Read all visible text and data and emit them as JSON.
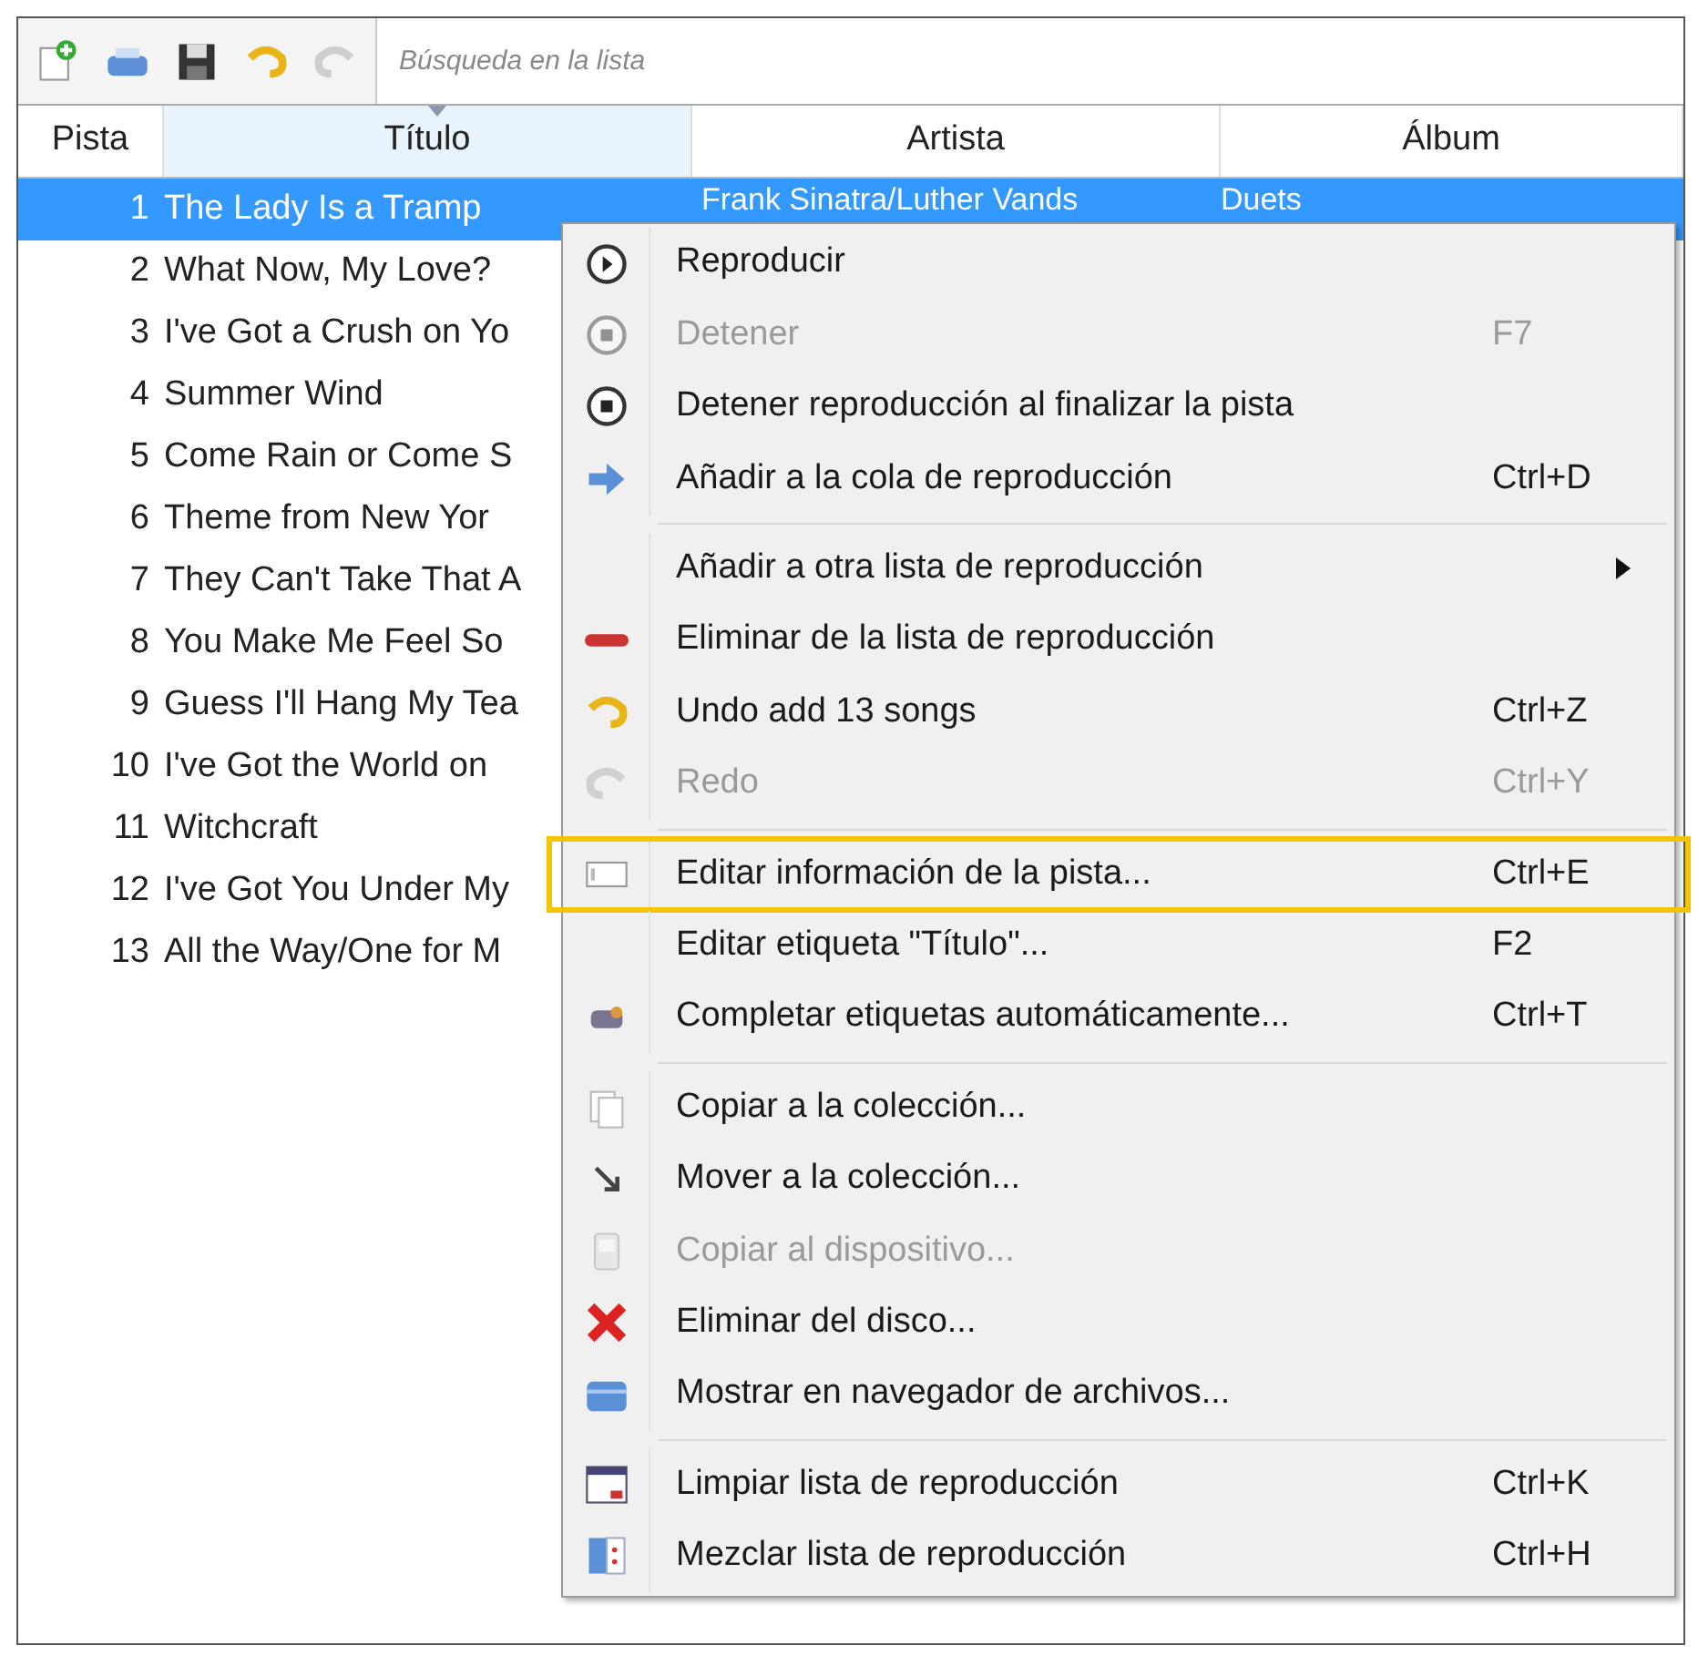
{
  "toolbar": {
    "buttons": [
      {
        "disabled": false
      },
      {
        "disabled": false
      },
      {
        "disabled": false
      },
      {
        "disabled": false
      },
      {
        "disabled": true
      }
    ],
    "search": {
      "placeholder": "Búsqueda en la lista"
    }
  },
  "table": {
    "columns": [
      {
        "label": "Pista",
        "sorted": false
      },
      {
        "label": "Título",
        "sorted": true
      },
      {
        "label": "Artista",
        "sorted": false
      },
      {
        "label": "Álbum",
        "sorted": false
      }
    ],
    "rows": [
      {
        "track": "1",
        "title": "The Lady Is a Tramp",
        "artist": "Frank Sinatra/Luther Vands",
        "album": "Duets",
        "selected": true
      },
      {
        "track": "2",
        "title": "What Now, My Love?",
        "selected": false
      },
      {
        "track": "3",
        "title": "I've Got a Crush on Yo",
        "selected": false
      },
      {
        "track": "4",
        "title": "Summer Wind",
        "selected": false
      },
      {
        "track": "5",
        "title": "Come Rain or Come S",
        "selected": false
      },
      {
        "track": "6",
        "title": "Theme from New Yor",
        "selected": false
      },
      {
        "track": "7",
        "title": "They Can't Take That A",
        "selected": false
      },
      {
        "track": "8",
        "title": "You Make Me Feel So",
        "selected": false
      },
      {
        "track": "9",
        "title": "Guess I'll Hang My Tea",
        "selected": false
      },
      {
        "track": "10",
        "title": "I've Got the World on",
        "selected": false
      },
      {
        "track": "11",
        "title": "Witchcraft",
        "selected": false
      },
      {
        "track": "12",
        "title": "I've Got You Under My",
        "selected": false
      },
      {
        "track": "13",
        "title": "All the Way/One for M",
        "selected": false
      }
    ]
  },
  "context_menu": {
    "items": [
      {
        "kind": "item",
        "label": "Reproducir",
        "disabled": false,
        "highlighted": false
      },
      {
        "kind": "item",
        "label": "Detener",
        "shortcut": "F7",
        "disabled": true,
        "highlighted": false
      },
      {
        "kind": "item",
        "label": "Detener reproducción al finalizar la pista",
        "disabled": false,
        "highlighted": false
      },
      {
        "kind": "item",
        "label": "Añadir a la cola de reproducción",
        "shortcut": "Ctrl+D",
        "disabled": false,
        "highlighted": false
      },
      {
        "kind": "separator"
      },
      {
        "kind": "item",
        "label": "Añadir a otra lista de reproducción",
        "submenu": true,
        "disabled": false,
        "highlighted": false
      },
      {
        "kind": "item",
        "label": "Eliminar de la lista de reproducción",
        "disabled": false,
        "highlighted": false
      },
      {
        "kind": "item",
        "label": "Undo add 13 songs",
        "shortcut": "Ctrl+Z",
        "disabled": false,
        "highlighted": false
      },
      {
        "kind": "item",
        "label": "Redo",
        "shortcut": "Ctrl+Y",
        "disabled": true,
        "highlighted": false
      },
      {
        "kind": "separator"
      },
      {
        "kind": "item",
        "label": "Editar información de la pista...",
        "shortcut": "Ctrl+E",
        "disabled": false,
        "highlighted": true
      },
      {
        "kind": "item",
        "label": "Editar etiqueta \"Título\"...",
        "shortcut": "F2",
        "disabled": false,
        "highlighted": false
      },
      {
        "kind": "item",
        "label": "Completar etiquetas automáticamente...",
        "shortcut": "Ctrl+T",
        "disabled": false,
        "highlighted": false
      },
      {
        "kind": "separator"
      },
      {
        "kind": "item",
        "label": "Copiar a la colección...",
        "disabled": false,
        "highlighted": false
      },
      {
        "kind": "item",
        "label": "Mover a la colección...",
        "disabled": false,
        "highlighted": false
      },
      {
        "kind": "item",
        "label": "Copiar al dispositivo...",
        "disabled": true,
        "highlighted": false
      },
      {
        "kind": "item",
        "label": "Eliminar del disco...",
        "disabled": false,
        "highlighted": false
      },
      {
        "kind": "item",
        "label": "Mostrar en navegador de archivos...",
        "disabled": false,
        "highlighted": false
      },
      {
        "kind": "separator"
      },
      {
        "kind": "item",
        "label": "Limpiar lista de reproducción",
        "shortcut": "Ctrl+K",
        "disabled": false,
        "highlighted": false
      },
      {
        "kind": "item",
        "label": "Mezclar lista de reproducción",
        "shortcut": "Ctrl+H",
        "disabled": false,
        "highlighted": false
      }
    ]
  }
}
